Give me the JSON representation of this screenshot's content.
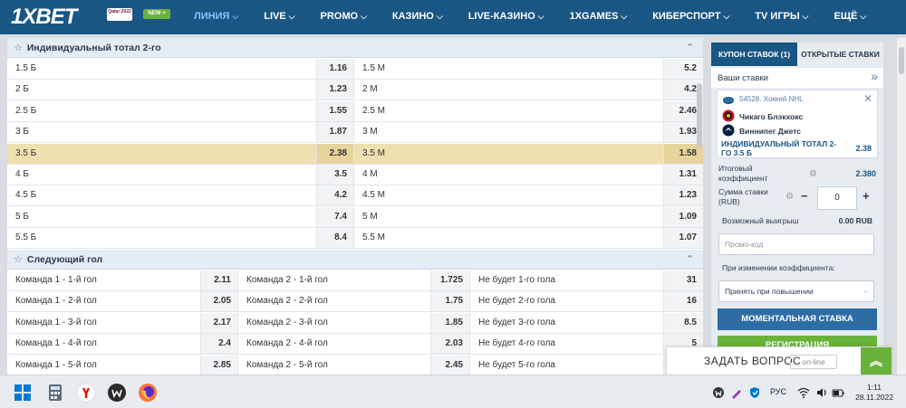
{
  "header": {
    "logo": "1XBET",
    "qatar_badge": "Qatar 2022",
    "new_badge": "NEW >",
    "nav": [
      {
        "label": "ЛИНИЯ",
        "active": true
      },
      {
        "label": "LIVE"
      },
      {
        "label": "PROMO"
      },
      {
        "label": "КАЗИНО"
      },
      {
        "label": "LIVE-КАЗИНО"
      },
      {
        "label": "1XGAMES"
      },
      {
        "label": "КИБЕРСПОРТ"
      },
      {
        "label": "TV ИГРЫ"
      },
      {
        "label": "ЕЩЁ"
      }
    ]
  },
  "section1": {
    "title": "Индивидуальный тотал 2-го",
    "rows": [
      {
        "a": "1.5 Б",
        "ao": "1.16",
        "b": "1.5 М",
        "bo": "5.2"
      },
      {
        "a": "2 Б",
        "ao": "1.23",
        "b": "2 М",
        "bo": "4.2"
      },
      {
        "a": "2.5 Б",
        "ao": "1.55",
        "b": "2.5 М",
        "bo": "2.46"
      },
      {
        "a": "3 Б",
        "ao": "1.87",
        "b": "3 М",
        "bo": "1.93"
      },
      {
        "a": "3.5 Б",
        "ao": "2.38",
        "b": "3.5 М",
        "bo": "1.58"
      },
      {
        "a": "4 Б",
        "ao": "3.5",
        "b": "4 М",
        "bo": "1.31"
      },
      {
        "a": "4.5 Б",
        "ao": "4.2",
        "b": "4.5 М",
        "bo": "1.23"
      },
      {
        "a": "5 Б",
        "ao": "7.4",
        "b": "5 М",
        "bo": "1.09"
      },
      {
        "a": "5.5 Б",
        "ao": "8.4",
        "b": "5.5 М",
        "bo": "1.07"
      }
    ]
  },
  "section2": {
    "title": "Следующий гол",
    "rows": [
      {
        "a": "Команда 1 - 1-й гол",
        "ao": "2.11",
        "b": "Команда 2 - 1-й гол",
        "bo": "1.725",
        "c": "Не будет 1-го гола",
        "co": "31"
      },
      {
        "a": "Команда 1 - 2-й гол",
        "ao": "2.05",
        "b": "Команда 2 - 2-й гол",
        "bo": "1.75",
        "c": "Не будет 2-го гола",
        "co": "16"
      },
      {
        "a": "Команда 1 - 3-й гол",
        "ao": "2.17",
        "b": "Команда 2 - 3-й гол",
        "bo": "1.85",
        "c": "Не будет 3-го гола",
        "co": "8.5"
      },
      {
        "a": "Команда 1 - 4-й гол",
        "ao": "2.4",
        "b": "Команда 2 - 4-й гол",
        "bo": "2.03",
        "c": "Не будет 4-го гола",
        "co": "5"
      },
      {
        "a": "Команда 1 - 5-й гол",
        "ao": "2.85",
        "b": "Команда 2 - 5-й гол",
        "bo": "2.45",
        "c": "Не будет 5-го гола",
        "co": "3.5"
      }
    ]
  },
  "coupon": {
    "tab1": "КУПОН СТАВОК (1)",
    "tab2": "ОТКРЫТЫЕ СТАВКИ",
    "my_bets": "Ваши ставки",
    "league": "54528. Хоккей NHL",
    "team1": "Чикаго Блэкхокс",
    "team2": "Виннипег Джетс",
    "market": "ИНДИВИДУАЛЬНЫЙ ТОТАЛ 2-ГО 3.5 Б",
    "market_odd": "2.38",
    "total_coef_label": "Итоговый коэффициент",
    "total_coef": "2.380",
    "stake_label": "Сумма ставки (RUB)",
    "stake_value": "0",
    "win_label": "Возможный выигрыш",
    "win_value": "0.00 RUB",
    "promo_placeholder": "Промо-код",
    "on_change_label": "При изменении коэффициента:",
    "on_change_value": "Принять при повышении",
    "instant_btn": "МОМЕНТАЛЬНАЯ СТАВКА",
    "register_btn": "РЕГИСТРАЦИЯ"
  },
  "chat": {
    "label": "ЗАДАТЬ ВОПРОС",
    "status": "on-line"
  },
  "taskbar": {
    "lang": "РУС",
    "time": "1:11",
    "date": "28.11.2022"
  }
}
